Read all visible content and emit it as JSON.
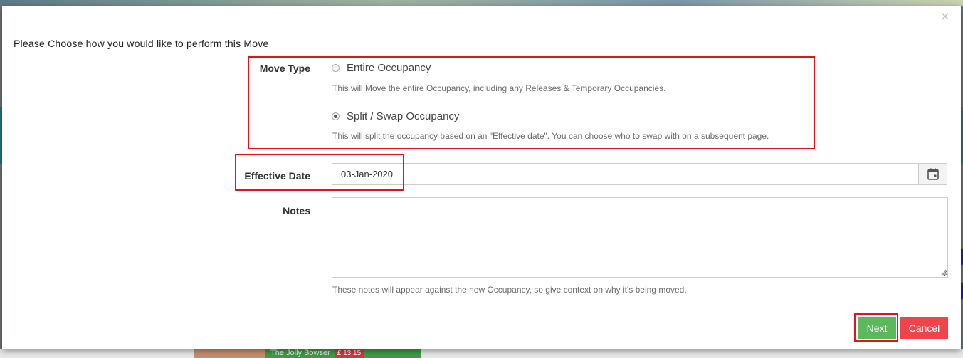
{
  "background": {
    "bottom_cell_text": "The Jolly Bowser",
    "bottom_cell_price": "£ 13.15"
  },
  "modal": {
    "close_glyph": "×",
    "title": "Please Choose how you would like to perform this Move",
    "move_type": {
      "label": "Move Type",
      "options": [
        {
          "label": "Entire Occupancy",
          "help": "This will Move the entire Occupancy, including any Releases & Temporary Occupancies.",
          "selected": false
        },
        {
          "label": "Split / Swap Occupancy",
          "help": "This will split the occupancy based on an \"Effective date\". You can choose who to swap with on a subsequent page.",
          "selected": true
        }
      ]
    },
    "effective_date": {
      "label": "Effective Date",
      "value": "03-Jan-2020",
      "icon": "calendar-icon"
    },
    "notes": {
      "label": "Notes",
      "value": "",
      "help": "These notes will appear against the new Occupancy, so give context on why it's being moved."
    },
    "buttons": {
      "next_label": "Next",
      "cancel_label": "Cancel"
    }
  },
  "colors": {
    "next": "#5cb85c",
    "cancel": "#f0444b",
    "highlight": "#e0141b"
  }
}
